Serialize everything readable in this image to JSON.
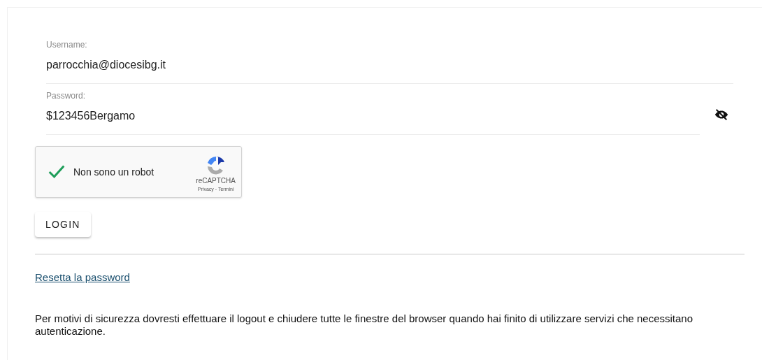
{
  "fields": [
    {
      "kind": "text",
      "label": "Username:",
      "value": "parrocchia@diocesibg.it"
    },
    {
      "kind": "password",
      "label": "Password:",
      "value": "$123456Bergamo",
      "revealed": true
    }
  ],
  "captcha": {
    "label": "Non sono un robot",
    "checked": true,
    "brand": "reCAPTCHA",
    "links": "Privacy - Termini"
  },
  "login_button": "LOGIN",
  "reset_link": "Resetta la password",
  "notice": "Per motivi di sicurezza dovresti effettuare il logout e chiudere tutte le finestre del browser quando hai finito di utilizzare servizi che necessitano autenticazione."
}
